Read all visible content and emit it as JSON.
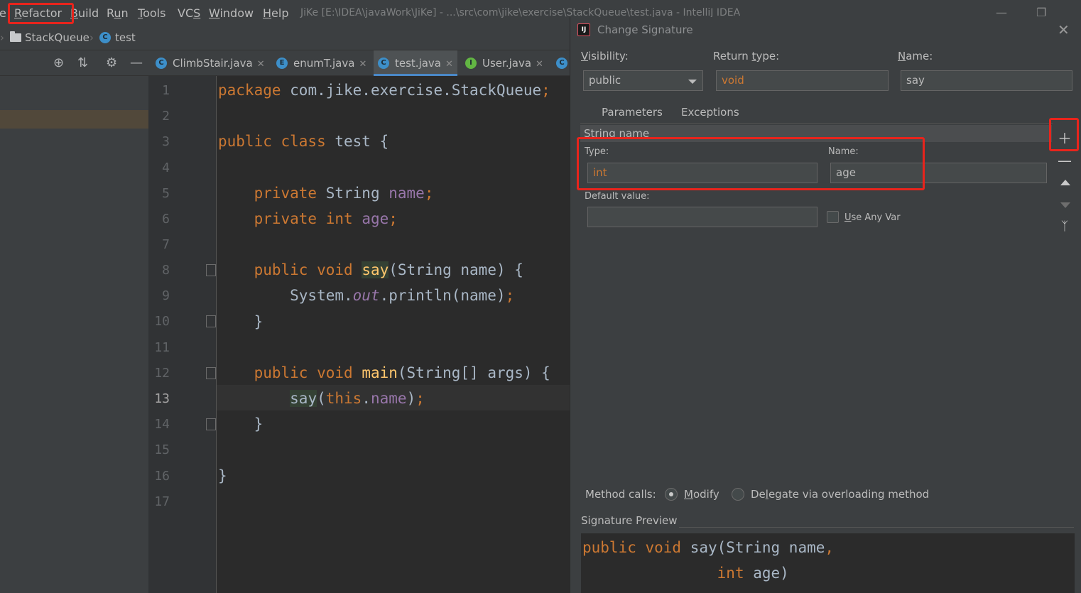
{
  "menu": {
    "partial": "e",
    "items": [
      {
        "pre": "",
        "u": "R",
        "post": "efactor"
      },
      {
        "pre": "",
        "u": "B",
        "post": "uild"
      },
      {
        "pre": "R",
        "u": "u",
        "post": "n"
      },
      {
        "pre": "",
        "u": "T",
        "post": "ools"
      },
      {
        "pre": "VC",
        "u": "S",
        "post": ""
      },
      {
        "pre": "",
        "u": "W",
        "post": "indow"
      },
      {
        "pre": "",
        "u": "H",
        "post": "elp"
      }
    ]
  },
  "window_title": "JiKe [E:\\IDEA\\javaWork\\JiKe] - ...\\src\\com\\jike\\exercise\\StackQueue\\test.java - IntelliJ IDEA",
  "breadcrumb": {
    "folder": "StackQueue",
    "file": "test",
    "file_icon_letter": "C"
  },
  "tabs": [
    {
      "label": "ClimbStair.java",
      "letter": "C",
      "color": "#3d8fc9",
      "active": false
    },
    {
      "label": "enumT.java",
      "letter": "E",
      "color": "#3d8fc9",
      "active": false
    },
    {
      "label": "test.java",
      "letter": "C",
      "color": "#3d8fc9",
      "active": true
    },
    {
      "label": "User.java",
      "letter": "I",
      "color": "#62b543",
      "active": false
    },
    {
      "label": "",
      "letter": "C",
      "color": "#3d8fc9",
      "active": false
    }
  ],
  "code": {
    "line_numbers": [
      "1",
      "2",
      "3",
      "4",
      "5",
      "6",
      "7",
      "8",
      "9",
      "10",
      "11",
      "12",
      "13",
      "14",
      "15",
      "16",
      "17"
    ],
    "current_line": "13"
  },
  "dialog": {
    "title": "Change Signature",
    "title_icon": "IJ",
    "visibility_label_u": "V",
    "visibility_label_rest": "isibility:",
    "visibility_value": "public",
    "return_type_label_pre": "Return ",
    "return_type_label_u": "t",
    "return_type_label_rest": "ype:",
    "return_type_value": "void",
    "name_label_u": "N",
    "name_label_rest": "ame:",
    "name_value": "say",
    "tab_parameters": "Parameters",
    "tab_exceptions": "Exceptions",
    "param_row": "String name",
    "type_label": "Type:",
    "type_value": "int",
    "pname_label": "Name:",
    "pname_value": "age",
    "default_label": "Default value:",
    "default_value": "",
    "use_any_var_u": "U",
    "use_any_var_rest": "se Any Var",
    "method_calls_label": "Method calls:",
    "modify_u": "M",
    "modify_rest": "odify",
    "delegate_pre": "De",
    "delegate_u": "l",
    "delegate_rest": "egate via overloading method",
    "preview_label": "Signature Preview",
    "preview_indent": "               "
  },
  "colors": {
    "accent": "#4a88c7",
    "annotation": "#e8241c",
    "keyword": "#cc7832",
    "field": "#9876aa",
    "method": "#ffc66d"
  }
}
